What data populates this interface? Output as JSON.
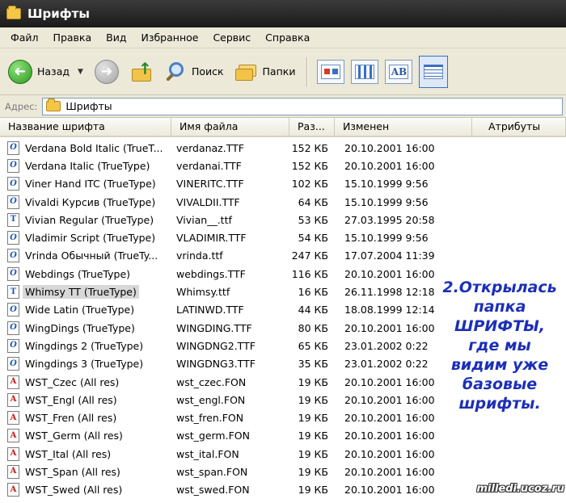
{
  "window": {
    "title": "Шрифты"
  },
  "menu": [
    "Файл",
    "Правка",
    "Вид",
    "Избранное",
    "Сервис",
    "Справка"
  ],
  "toolbar": {
    "back_label": "Назад",
    "back_arrow": "➜",
    "forward_arrow": "➜",
    "up_arrow": "↑",
    "dropdown_glyph": "▼",
    "search_label": "Поиск",
    "folders_label": "Папки",
    "view_ab_glyph": "AB"
  },
  "address": {
    "label": "Адрес:",
    "value": "Шрифты"
  },
  "columns": [
    "Название шрифта",
    "Имя файла",
    "Раз...",
    "Изменен",
    "Атрибуты"
  ],
  "files": [
    {
      "name": "Verdana Bold Italic (TrueT...",
      "file": "verdanaz.TTF",
      "size": "152 КБ",
      "modified": "20.10.2001 16:00",
      "icon": "opentype",
      "glyph": "O"
    },
    {
      "name": "Verdana Italic (TrueType)",
      "file": "verdanai.TTF",
      "size": "152 КБ",
      "modified": "20.10.2001 16:00",
      "icon": "opentype",
      "glyph": "O"
    },
    {
      "name": "Viner Hand ITC (TrueType)",
      "file": "VINERITC.TTF",
      "size": "102 КБ",
      "modified": "15.10.1999 9:56",
      "icon": "opentype",
      "glyph": "O"
    },
    {
      "name": "Vivaldi Курсив (TrueType)",
      "file": "VIVALDII.TTF",
      "size": "64 КБ",
      "modified": "15.10.1999 9:56",
      "icon": "opentype",
      "glyph": "O"
    },
    {
      "name": "Vivian Regular (TrueType)",
      "file": "Vivian__.ttf",
      "size": "53 КБ",
      "modified": "27.03.1995 20:58",
      "icon": "truetype",
      "glyph": "T"
    },
    {
      "name": "Vladimir Script (TrueType)",
      "file": "VLADIMIR.TTF",
      "size": "54 КБ",
      "modified": "15.10.1999 9:56",
      "icon": "opentype",
      "glyph": "O"
    },
    {
      "name": "Vrinda Обычный (TrueTy...",
      "file": "vrinda.ttf",
      "size": "247 КБ",
      "modified": "17.07.2004 11:39",
      "icon": "opentype",
      "glyph": "O"
    },
    {
      "name": "Webdings (TrueType)",
      "file": "webdings.TTF",
      "size": "116 КБ",
      "modified": "20.10.2001 16:00",
      "icon": "opentype",
      "glyph": "O"
    },
    {
      "name": "Whimsy TT (TrueType)",
      "file": "Whimsy.ttf",
      "size": "16 КБ",
      "modified": "26.11.1998 12:18",
      "icon": "truetype",
      "glyph": "T",
      "selected": true
    },
    {
      "name": "Wide Latin (TrueType)",
      "file": "LATINWD.TTF",
      "size": "44 КБ",
      "modified": "18.08.1999 12:14",
      "icon": "opentype",
      "glyph": "O"
    },
    {
      "name": "WingDings (TrueType)",
      "file": "WINGDING.TTF",
      "size": "80 КБ",
      "modified": "20.10.2001 16:00",
      "icon": "opentype",
      "glyph": "O"
    },
    {
      "name": "Wingdings 2 (TrueType)",
      "file": "WINGDNG2.TTF",
      "size": "65 КБ",
      "modified": "23.01.2002 0:22",
      "icon": "opentype",
      "glyph": "O"
    },
    {
      "name": "Wingdings 3 (TrueType)",
      "file": "WINGDNG3.TTF",
      "size": "35 КБ",
      "modified": "23.01.2002 0:22",
      "icon": "opentype",
      "glyph": "O"
    },
    {
      "name": "WST_Czec (All res)",
      "file": "wst_czec.FON",
      "size": "19 КБ",
      "modified": "20.10.2001 16:00",
      "icon": "raster",
      "glyph": "A"
    },
    {
      "name": "WST_Engl (All res)",
      "file": "wst_engl.FON",
      "size": "19 КБ",
      "modified": "20.10.2001 16:00",
      "icon": "raster",
      "glyph": "A"
    },
    {
      "name": "WST_Fren (All res)",
      "file": "wst_fren.FON",
      "size": "19 КБ",
      "modified": "20.10.2001 16:00",
      "icon": "raster",
      "glyph": "A"
    },
    {
      "name": "WST_Germ (All res)",
      "file": "wst_germ.FON",
      "size": "19 КБ",
      "modified": "20.10.2001 16:00",
      "icon": "raster",
      "glyph": "A"
    },
    {
      "name": "WST_Ital (All res)",
      "file": "wst_ital.FON",
      "size": "19 КБ",
      "modified": "20.10.2001 16:00",
      "icon": "raster",
      "glyph": "A"
    },
    {
      "name": "WST_Span (All res)",
      "file": "wst_span.FON",
      "size": "19 КБ",
      "modified": "20.10.2001 16:00",
      "icon": "raster",
      "glyph": "A"
    },
    {
      "name": "WST_Swed (All res)",
      "file": "wst_swed.FON",
      "size": "19 КБ",
      "modified": "20.10.2001 16:00",
      "icon": "raster",
      "glyph": "A"
    }
  ],
  "annotation": "2.Открылась\nпапка\nШРИФТЫ,\nгде мы\nвидим уже\nбазовые\nшрифты.",
  "watermark": "milledi.ucoz.ru",
  "colors": {
    "annotation": "#1c2fb8",
    "selection": "#d8d8d8",
    "titlebar": "#2a2a2a"
  }
}
